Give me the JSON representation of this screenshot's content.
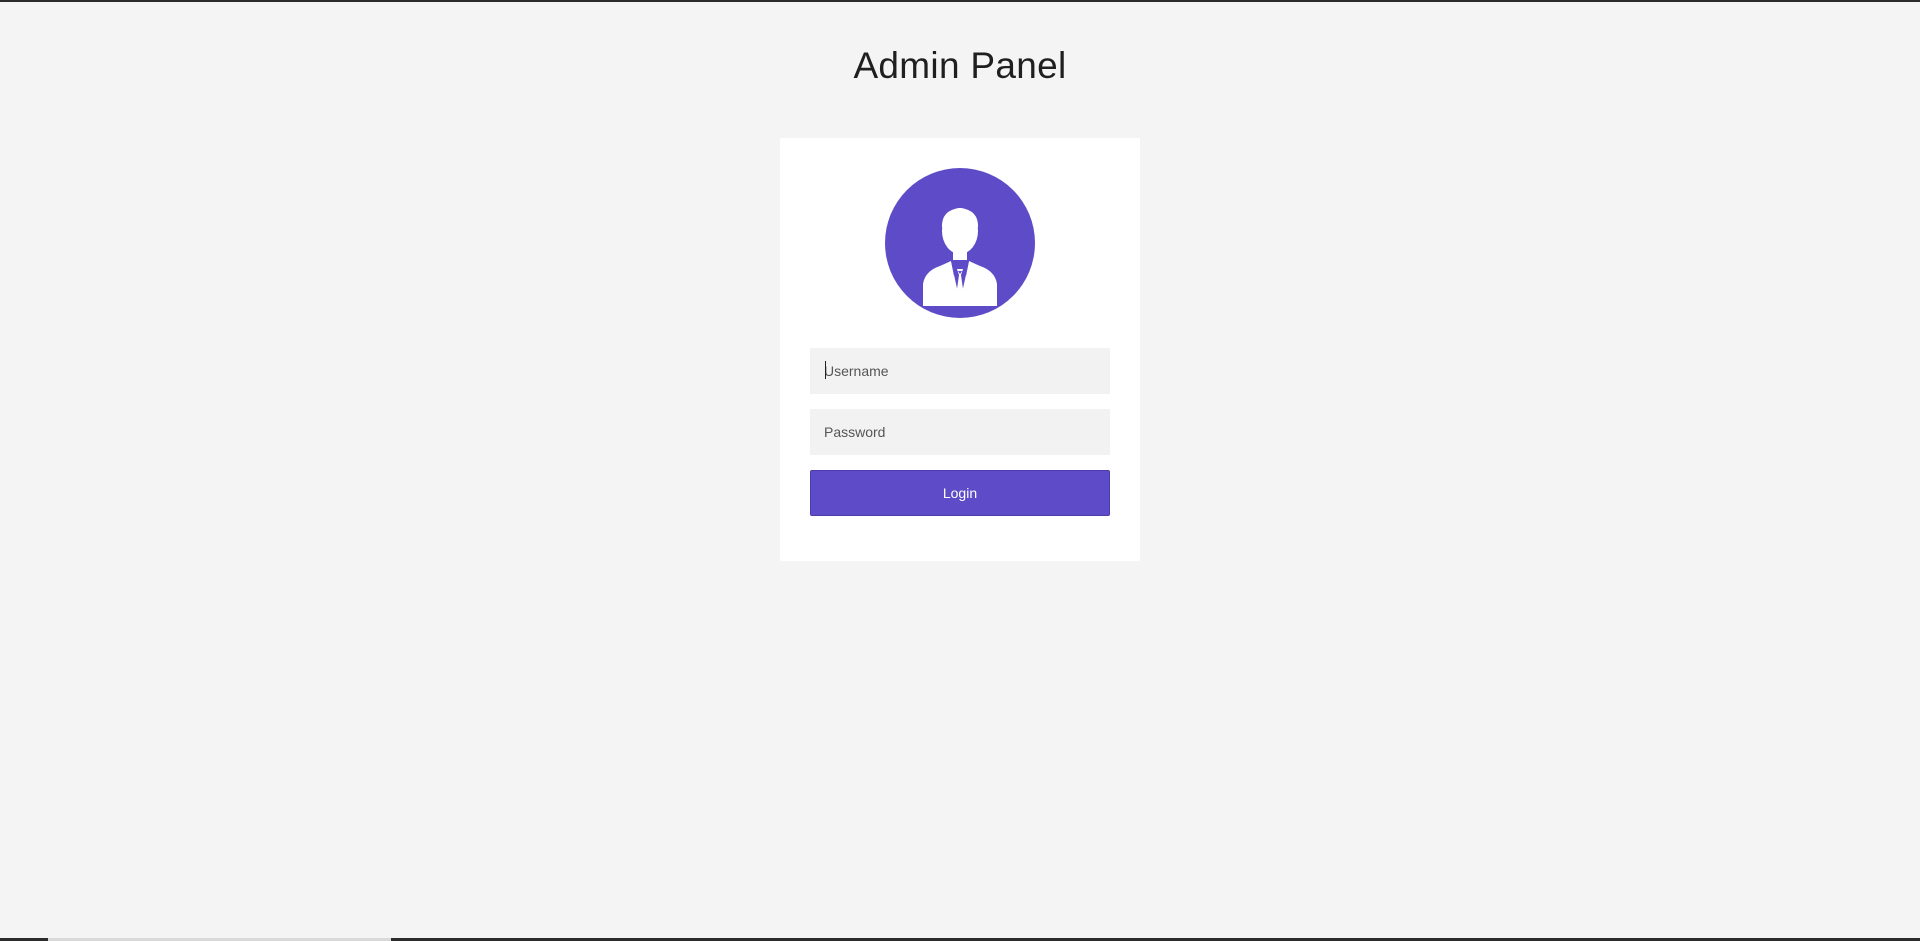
{
  "header": {
    "title": "Admin Panel"
  },
  "login_form": {
    "avatar_icon": "user-businessman-icon",
    "username": {
      "value": "",
      "placeholder": "Username"
    },
    "password": {
      "value": "",
      "placeholder": "Password"
    },
    "submit_label": "Login"
  },
  "colors": {
    "accent": "#5e4bc8",
    "background": "#f4f4f4",
    "card": "#ffffff",
    "input_background": "#f2f2f2"
  }
}
